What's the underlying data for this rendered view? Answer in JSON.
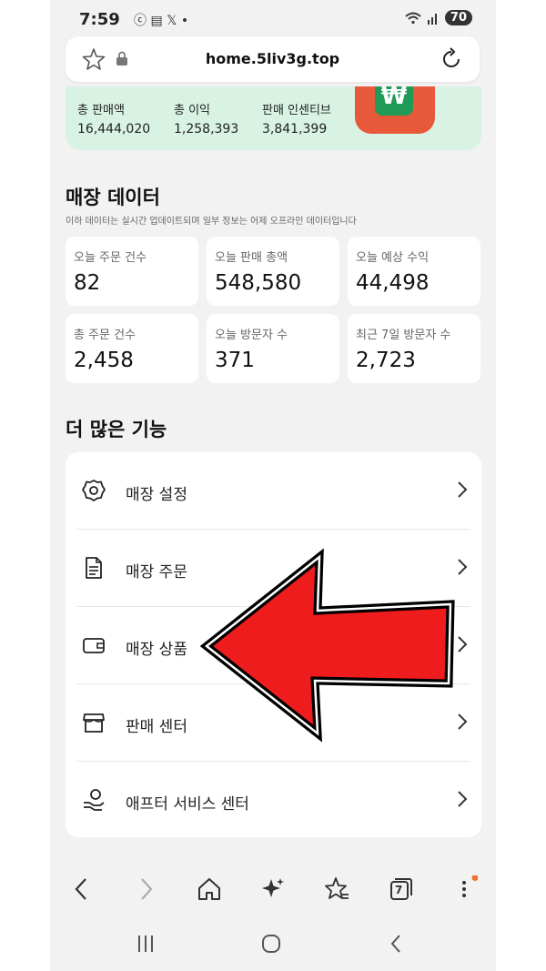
{
  "status_bar": {
    "time": "7:59",
    "indicators": "ⓒ ▤ 𝕏 •",
    "battery": "70"
  },
  "browser": {
    "url": "home.5liv3g.top"
  },
  "banner": {
    "stats": [
      {
        "label": "총 판매액",
        "value": "16,444,020"
      },
      {
        "label": "총 이익",
        "value": "1,258,393"
      },
      {
        "label": "판매 인센티브",
        "value": "3,841,399"
      }
    ],
    "wallet_symbol": "₩"
  },
  "store_data": {
    "title": "매장 데이터",
    "subtitle": "이하 데이터는 실시간 업데이트되며 일부 정보는 어제 오프라인 데이터입니다",
    "cards": [
      {
        "label": "오늘 주문 건수",
        "value": "82"
      },
      {
        "label": "오늘 판매 총액",
        "value": "548,580"
      },
      {
        "label": "오늘 예상 수익",
        "value": "44,498"
      },
      {
        "label": "총 주문 건수",
        "value": "2,458"
      },
      {
        "label": "오늘 방문자 수",
        "value": "371"
      },
      {
        "label": "최근 7일 방문자 수",
        "value": "2,723"
      }
    ]
  },
  "features": {
    "title": "더 많은 기능",
    "items": [
      {
        "label": "매장 설정",
        "icon": "gear-icon"
      },
      {
        "label": "매장 주문",
        "icon": "document-icon"
      },
      {
        "label": "매장 상품",
        "icon": "wallet-icon"
      },
      {
        "label": "판매 센터",
        "icon": "store-icon"
      },
      {
        "label": "애프터 서비스 센터",
        "icon": "service-hand-icon"
      }
    ]
  },
  "bottom_nav": {
    "tabs_count": "7"
  },
  "colors": {
    "banner_bg": "#d8f2e4",
    "arrow_fill": "#ee1c1c",
    "wallet_orange": "#e8583b",
    "card_green": "#1f9a57",
    "notification_dot": "#f07030"
  }
}
